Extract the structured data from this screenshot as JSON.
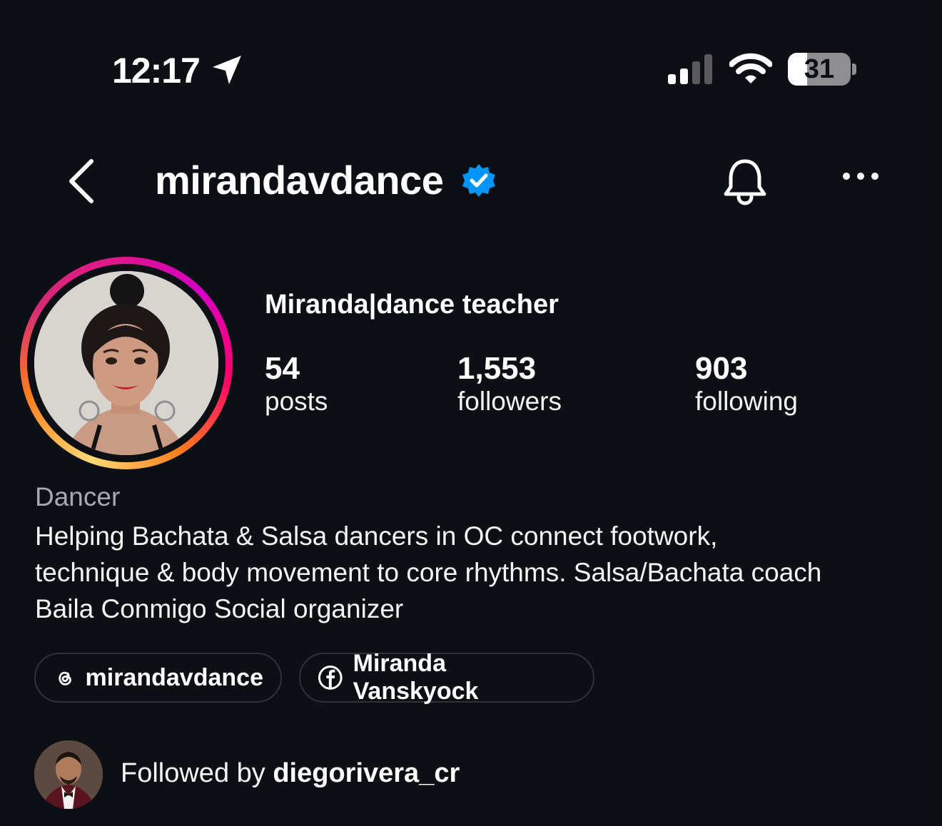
{
  "status_bar": {
    "time": "12:17",
    "battery_percent": "31",
    "battery_level": 0.31,
    "signal_bars_active": 2,
    "signal_bars_total": 4
  },
  "header": {
    "username": "mirandavdance",
    "verified": true
  },
  "profile": {
    "display_name": "Miranda|dance teacher",
    "stats": [
      {
        "value": "54",
        "label": "posts"
      },
      {
        "value": "1,553",
        "label": "followers"
      },
      {
        "value": "903",
        "label": "following"
      }
    ],
    "category": "Dancer",
    "bio_lines": [
      "Helping Bachata & Salsa dancers in OC connect footwork,",
      "technique & body movement to core rhythms. Salsa/Bachata coach",
      "Baila Conmigo Social organizer"
    ],
    "links": [
      {
        "icon": "threads-icon",
        "label": "mirandavdance"
      },
      {
        "icon": "facebook-icon",
        "label": "Miranda Vanskyock"
      }
    ],
    "followed_by_prefix": "Followed by",
    "followed_by_user": "diegorivera_cr"
  },
  "colors": {
    "background": "#0c1014",
    "verified_blue": "#0095f6",
    "muted_text": "#a8a8b3",
    "pill_border": "#2f3338"
  }
}
